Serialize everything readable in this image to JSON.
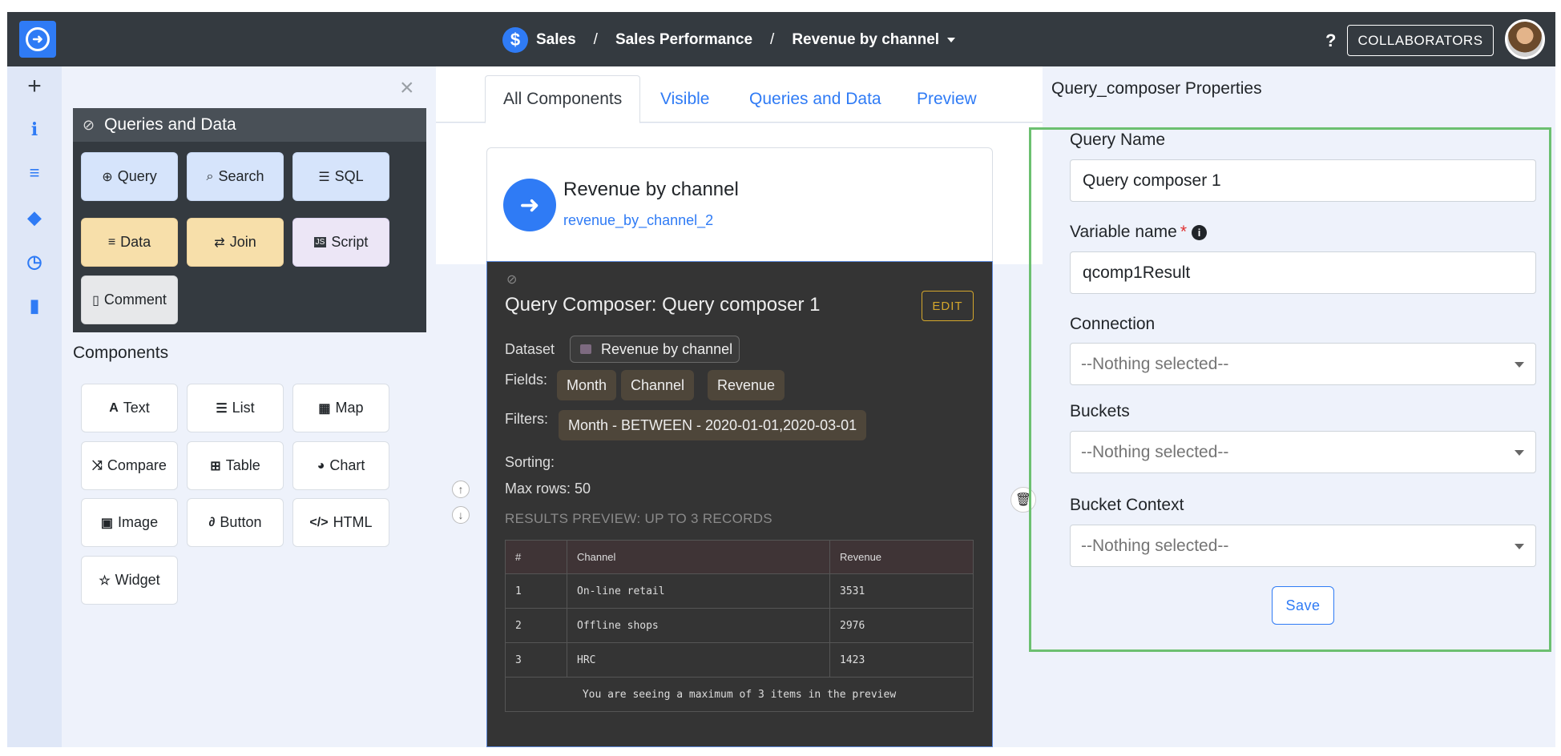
{
  "header": {
    "breadcrumb": [
      "Sales",
      "Sales Performance",
      "Revenue by channel"
    ],
    "separator": "/",
    "help": "?",
    "collaborators_label": "COLLABORATORS",
    "currency_symbol": "$",
    "bolt_symbol": "➜"
  },
  "rail": {
    "items": [
      {
        "icon": "plus-icon",
        "glyph": "+"
      },
      {
        "icon": "info-icon",
        "glyph": "i"
      },
      {
        "icon": "database-icon",
        "glyph": "≡"
      },
      {
        "icon": "tags-icon",
        "glyph": "◆"
      },
      {
        "icon": "clock-icon",
        "glyph": "◷"
      },
      {
        "icon": "file-icon",
        "glyph": "▮"
      }
    ]
  },
  "left_panel": {
    "close_glyph": "×",
    "queries_title": "Queries and Data",
    "queries": [
      {
        "label": "Query",
        "glyph": "⊕"
      },
      {
        "label": "Search",
        "glyph": "⌕"
      },
      {
        "label": "SQL",
        "glyph": "☰"
      },
      {
        "label": "Data",
        "glyph": "≡"
      },
      {
        "label": "Join",
        "glyph": "⇄"
      },
      {
        "label": "Script",
        "glyph": "JS"
      },
      {
        "label": "Comment",
        "glyph": "▯"
      }
    ],
    "components_title": "Components",
    "components": [
      {
        "label": "Text",
        "glyph": "A"
      },
      {
        "label": "List",
        "glyph": "☰"
      },
      {
        "label": "Map",
        "glyph": "▦"
      },
      {
        "label": "Compare",
        "glyph": "⤨"
      },
      {
        "label": "Table",
        "glyph": "⊞"
      },
      {
        "label": "Chart",
        "glyph": "◕"
      },
      {
        "label": "Image",
        "glyph": "▣"
      },
      {
        "label": "Button",
        "glyph": "∂"
      },
      {
        "label": "HTML",
        "glyph": "</>"
      },
      {
        "label": "Widget",
        "glyph": "☆"
      }
    ]
  },
  "middle": {
    "tabs": [
      "All Components",
      "Visible",
      "Queries and Data",
      "Preview"
    ],
    "active_tab": "All Components",
    "card": {
      "title": "Revenue by channel",
      "subtitle": "revenue_by_channel_2"
    },
    "query_composer": {
      "title": "Query Composer: Query composer 1",
      "edit_label": "EDIT",
      "dataset_label": "Dataset",
      "dataset_value": "Revenue by channel",
      "fields_label": "Fields:",
      "fields": [
        "Month",
        "Channel",
        "Revenue"
      ],
      "filters_label": "Filters:",
      "filter_value": "Month - BETWEEN - 2020-01-01,2020-03-01",
      "sorting_label": "Sorting:",
      "max_rows_label": "Max rows: 50",
      "preview_label": "RESULTS PREVIEW: UP TO 3 RECORDS",
      "table": {
        "headers": [
          "#",
          "Channel",
          "Revenue"
        ],
        "rows": [
          [
            "1",
            "On-line retail",
            "3531"
          ],
          [
            "2",
            "Offline shops",
            "2976"
          ],
          [
            "3",
            "HRC",
            "1423"
          ]
        ],
        "note": "You are seeing a maximum of 3 items in the preview"
      }
    }
  },
  "right_panel": {
    "title": "Query_composer Properties",
    "query_name_label": "Query Name",
    "query_name_value": "Query composer 1",
    "variable_name_label": "Variable name",
    "required_mark": "*",
    "variable_name_value": "qcomp1Result",
    "connection_label": "Connection",
    "connection_value": "--Nothing selected--",
    "buckets_label": "Buckets",
    "buckets_value": "--Nothing selected--",
    "bucket_context_label": "Bucket Context",
    "bucket_context_value": "--Nothing selected--",
    "save_label": "Save"
  },
  "colors": {
    "accent": "#2f7bf5",
    "topbar": "#343a40",
    "highlight_green": "#6cc070",
    "edit_gold": "#d4a72c"
  }
}
